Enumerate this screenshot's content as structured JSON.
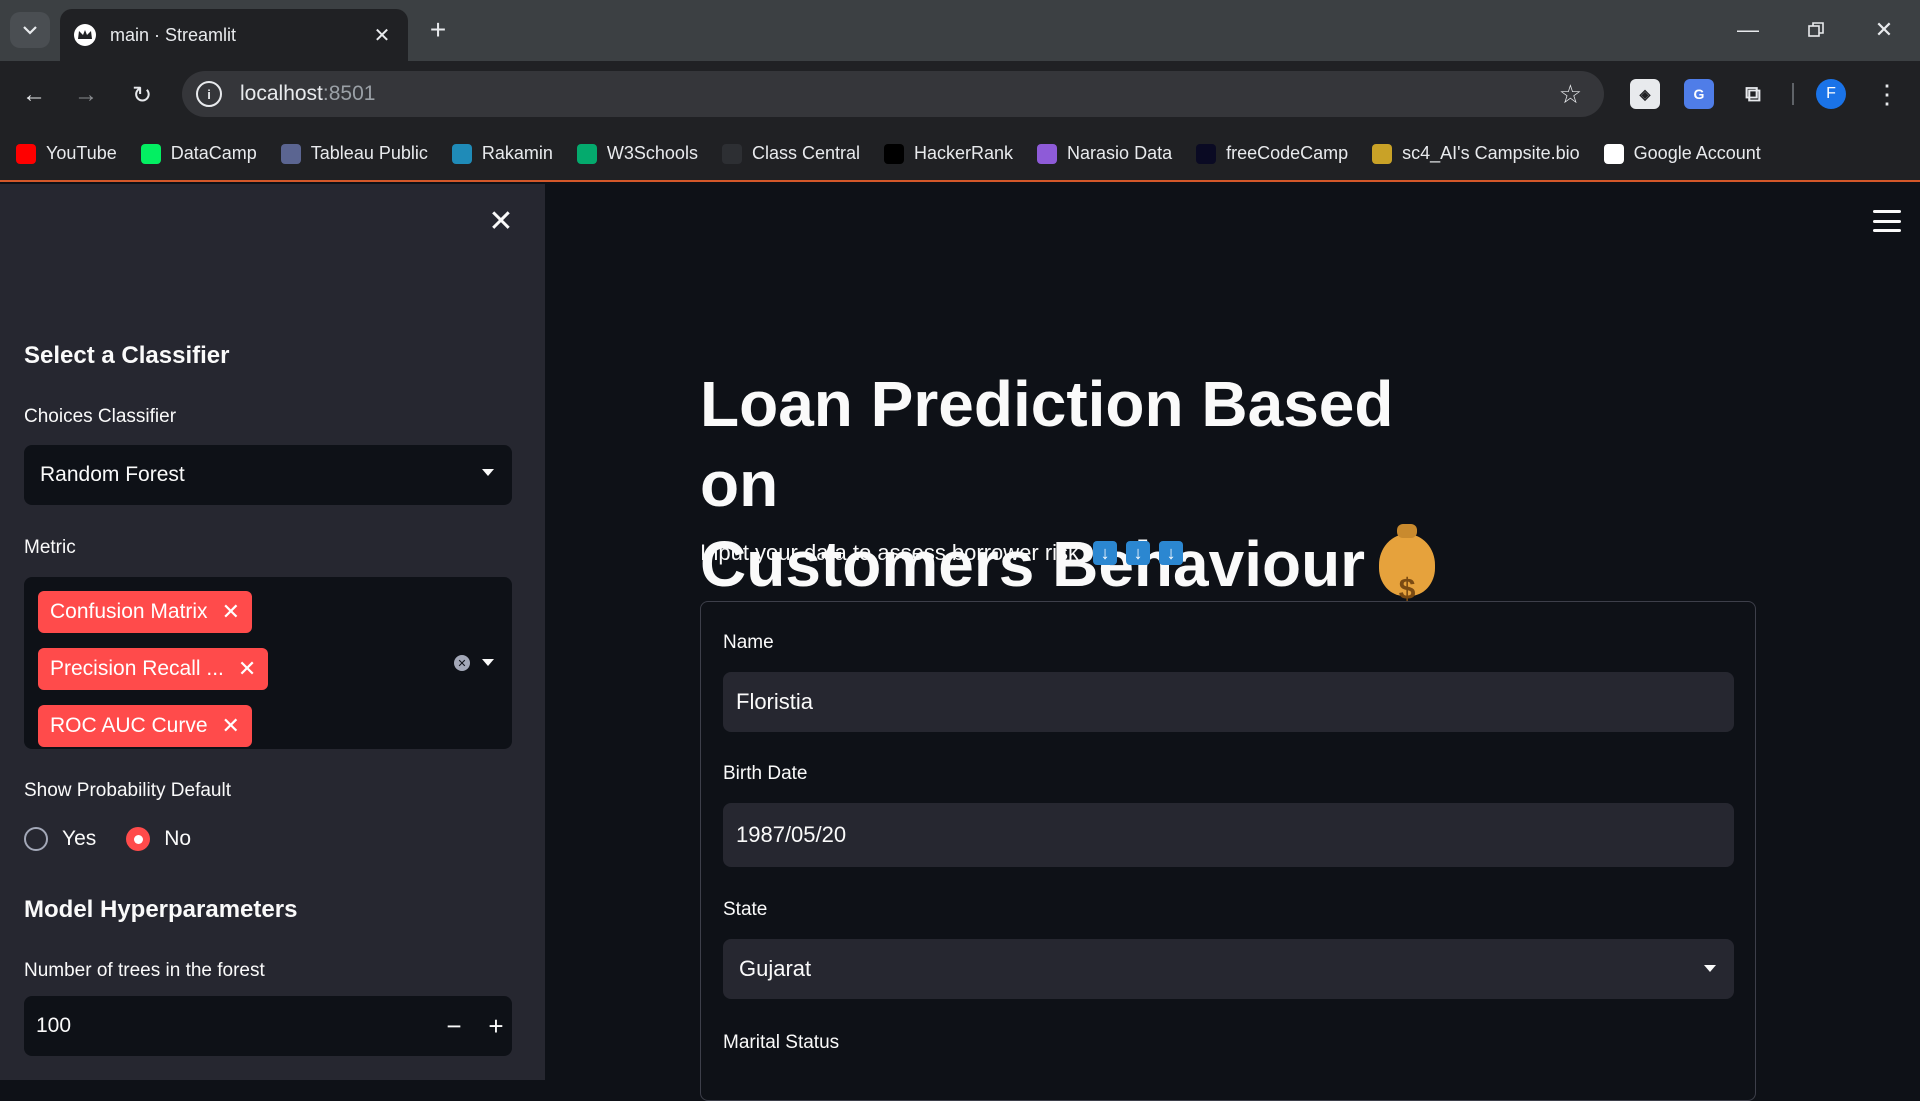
{
  "browser": {
    "tab_title": "main · Streamlit",
    "url_host": "localhost",
    "url_port": ":8501",
    "profile_initial": "F",
    "bookmarks": [
      {
        "label": "YouTube",
        "icon": "youtube-icon",
        "color": "#ff0000"
      },
      {
        "label": "DataCamp",
        "icon": "datacamp-icon",
        "color": "#03ef62"
      },
      {
        "label": "Tableau Public",
        "icon": "tableau-icon",
        "color": "#5b6591"
      },
      {
        "label": "Rakamin",
        "icon": "rakamin-icon",
        "color": "#1f8bb8"
      },
      {
        "label": "W3Schools",
        "icon": "w3schools-icon",
        "color": "#04aa6d"
      },
      {
        "label": "Class Central",
        "icon": "classcentral-icon",
        "color": "#2d2f33"
      },
      {
        "label": "HackerRank",
        "icon": "hackerrank-icon",
        "color": "#000000"
      },
      {
        "label": "Narasio Data",
        "icon": "narasio-icon",
        "color": "#8e5bd8"
      },
      {
        "label": "freeCodeCamp",
        "icon": "freecodecamp-icon",
        "color": "#0a0a23"
      },
      {
        "label": "sc4_AI's Campsite.bio",
        "icon": "campsite-icon",
        "color": "#c9a227"
      },
      {
        "label": "Google Account",
        "icon": "google-icon",
        "color": "#ffffff"
      }
    ]
  },
  "sidebar": {
    "heading_classifier": "Select a Classifier",
    "choices_label": "Choices Classifier",
    "classifier_value": "Random Forest",
    "metric_label": "Metric",
    "metrics": [
      "Confusion Matrix",
      "Precision Recall ...",
      "ROC AUC Curve"
    ],
    "probability_label": "Show Probability Default",
    "radio_options": [
      "Yes",
      "No"
    ],
    "radio_selected": "No",
    "heading_hyper": "Model Hyperparameters",
    "trees_label": "Number of trees in the forest",
    "trees_value": "100"
  },
  "main": {
    "title_line1": "Loan Prediction Based on",
    "title_line2": "Customers Behaviour",
    "subtitle": "Input your data to assess borrower risk",
    "form": {
      "name_label": "Name",
      "name_value": "Floristia",
      "birth_label": "Birth Date",
      "birth_value": "1987/05/20",
      "state_label": "State",
      "state_value": "Gujarat",
      "marital_label": "Marital Status"
    }
  },
  "colors": {
    "accent": "#ff4b4b",
    "sidebar_bg": "#262730",
    "main_bg": "#0e1117"
  }
}
